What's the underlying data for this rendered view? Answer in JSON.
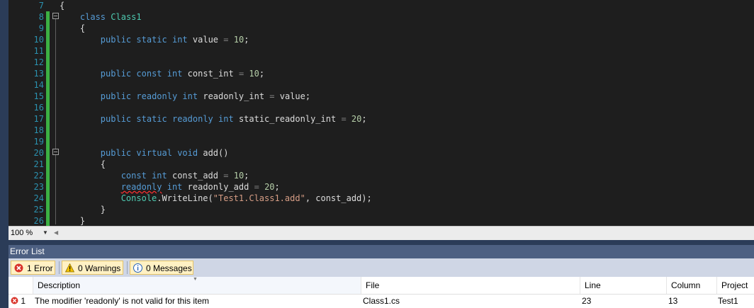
{
  "editor": {
    "lines": [
      {
        "num": "7"
      },
      {
        "num": "8"
      },
      {
        "num": "9"
      },
      {
        "num": "10"
      },
      {
        "num": "11"
      },
      {
        "num": "12"
      },
      {
        "num": "13"
      },
      {
        "num": "14"
      },
      {
        "num": "15"
      },
      {
        "num": "16"
      },
      {
        "num": "17"
      },
      {
        "num": "18"
      },
      {
        "num": "19"
      },
      {
        "num": "20"
      },
      {
        "num": "21"
      },
      {
        "num": "22"
      },
      {
        "num": "23"
      },
      {
        "num": "24"
      },
      {
        "num": "25"
      },
      {
        "num": "26"
      }
    ],
    "tokens": {
      "brace_open": "{",
      "brace_close": "}",
      "kw_class": "class",
      "class_name": "Class1",
      "kw_public": "public",
      "kw_static": "static",
      "kw_int": "int",
      "kw_const": "const",
      "kw_readonly": "readonly",
      "kw_virtual": "virtual",
      "kw_void": "void",
      "id_value": "value",
      "id_const_int": "const_int",
      "id_readonly_int": "readonly_int",
      "id_static_readonly_int": "static_readonly_int",
      "id_add": "add()",
      "id_const_add": "const_add",
      "id_readonly_add": "readonly_add",
      "console": "Console",
      "writeline": ".WriteLine(",
      "string_lit": "\"Test1.Class1.add\"",
      "call_tail": ", const_add);",
      "eq": "=",
      "semi": ";",
      "num_10": "10",
      "num_20": "20",
      "value_ref": "value;"
    }
  },
  "zoom": {
    "level": "100 %"
  },
  "error_list": {
    "title": "Error List",
    "filters": {
      "errors": "1 Error",
      "warnings": "0 Warnings",
      "messages": "0 Messages"
    },
    "columns": [
      "Description",
      "File",
      "Line",
      "Column",
      "Project"
    ],
    "rows": [
      {
        "index": "1",
        "description": "The modifier 'readonly' is not valid for this item",
        "file": "Class1.cs",
        "line": "23",
        "column": "13",
        "project": "Test1"
      }
    ]
  },
  "colors": {
    "editor_bg": "#1e1e1e",
    "keyword": "#569cd6",
    "type": "#4ec9b0",
    "number": "#b5cea8",
    "string": "#d69d85",
    "line_number": "#2b91af",
    "change_bar": "#3cb043",
    "error_icon": "#d9342b",
    "warning_icon": "#f2c200",
    "info_icon": "#1f5fb8"
  },
  "icons": {
    "error": "error-icon",
    "warning": "warning-icon",
    "info": "info-icon"
  }
}
